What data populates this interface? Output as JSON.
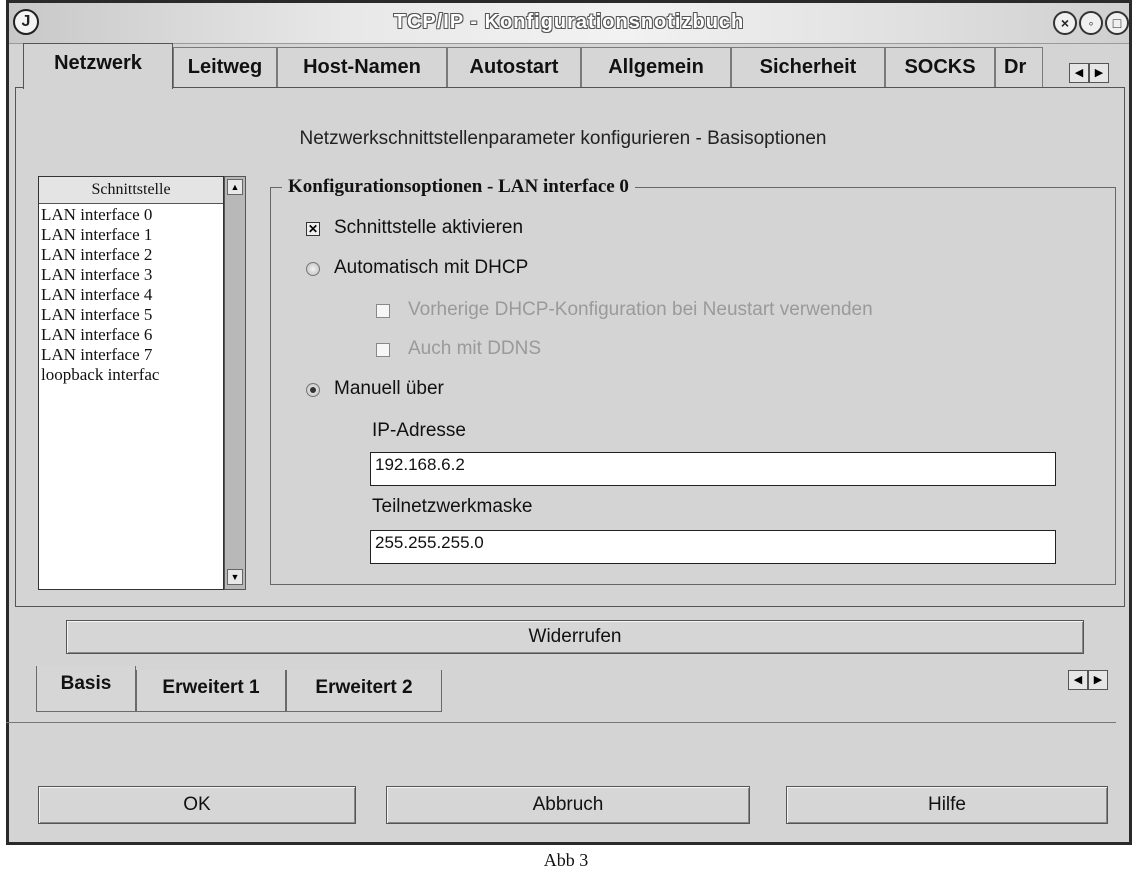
{
  "window": {
    "title": "TCP/IP - Konfigurationsnotizbuch",
    "app_icon": "J"
  },
  "top_tabs": [
    {
      "label": "Netzwerk",
      "active": true
    },
    {
      "label": "Leitweg"
    },
    {
      "label": "Host-Namen"
    },
    {
      "label": "Autostart"
    },
    {
      "label": "Allgemein"
    },
    {
      "label": "Sicherheit"
    },
    {
      "label": "SOCKS"
    },
    {
      "label": "Dr"
    }
  ],
  "page_subtitle": "Netzwerkschnittstellenparameter konfigurieren - Basisoptionen",
  "interface_list": {
    "header": "Schnittstelle",
    "items": [
      "LAN interface 0",
      "LAN interface 1",
      "LAN interface 2",
      "LAN interface 3",
      "LAN interface 4",
      "LAN interface 5",
      "LAN interface 6",
      "LAN interface 7",
      "loopback interfac"
    ]
  },
  "config": {
    "group_title": "Konfigurationsoptionen - LAN interface 0",
    "enable_label": "Schnittstelle aktivieren",
    "enable_checked": true,
    "dhcp_label": "Automatisch mit DHCP",
    "dhcp_prev_label": "Vorherige DHCP-Konfiguration bei Neustart verwenden",
    "ddns_label": "Auch mit DDNS",
    "manual_label": "Manuell über",
    "ip_label": "IP-Adresse",
    "ip_value": "192.168.6.2",
    "mask_label": "Teilnetzwerkmaske",
    "mask_value": "255.255.255.0"
  },
  "undo_button": "Widerrufen",
  "bottom_tabs": [
    {
      "label": "Basis",
      "active": true
    },
    {
      "label": "Erweitert 1"
    },
    {
      "label": "Erweitert 2"
    }
  ],
  "footer_buttons": {
    "ok": "OK",
    "cancel": "Abbruch",
    "help": "Hilfe"
  },
  "caption": "Abb 3"
}
